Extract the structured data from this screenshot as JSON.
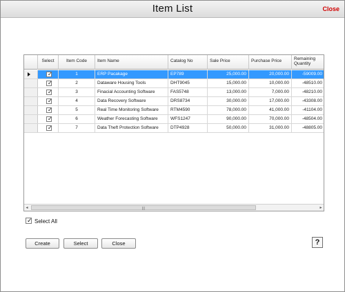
{
  "window": {
    "title": "Item List",
    "close_label": "Close"
  },
  "grid": {
    "columns": [
      "Select",
      "Item Code",
      "Item Name",
      "Catalog No",
      "Sale Price",
      "Purchase Price",
      "Remaining Quantity"
    ],
    "rows": [
      {
        "selected": true,
        "checked": true,
        "code": "1",
        "name": "ERP Pacakage",
        "catalog": "EP789",
        "sale": "25,000.00",
        "purchase": "20,000.00",
        "remaining": "-59009.00"
      },
      {
        "selected": false,
        "checked": true,
        "code": "2",
        "name": "Dataware Housing Tools",
        "catalog": "DHT9045",
        "sale": "15,000.00",
        "purchase": "10,000.00",
        "remaining": "-48510.00"
      },
      {
        "selected": false,
        "checked": true,
        "code": "3",
        "name": "Finacial Accounting Software",
        "catalog": "FAS5748",
        "sale": "13,000.00",
        "purchase": "7,000.00",
        "remaining": "-48210.00"
      },
      {
        "selected": false,
        "checked": true,
        "code": "4",
        "name": "Data Recovery Software",
        "catalog": "DRS8734",
        "sale": "30,000.00",
        "purchase": "17,000.00",
        "remaining": "-43308.00"
      },
      {
        "selected": false,
        "checked": true,
        "code": "5",
        "name": "Real Time Monitoring Software",
        "catalog": "RTM4590",
        "sale": "78,000.00",
        "purchase": "41,000.00",
        "remaining": "-41104.00"
      },
      {
        "selected": false,
        "checked": true,
        "code": "6",
        "name": "Weather Forecasting Software",
        "catalog": "WFS1247",
        "sale": "90,000.00",
        "purchase": "70,000.00",
        "remaining": "-48504.00"
      },
      {
        "selected": false,
        "checked": true,
        "code": "7",
        "name": "Data Theft Protection Software",
        "catalog": "DTP4928",
        "sale": "50,000.00",
        "purchase": "31,000.00",
        "remaining": "-48805.00"
      }
    ]
  },
  "select_all": {
    "label": "Select All",
    "checked": true
  },
  "buttons": {
    "create": "Create",
    "select": "Select",
    "close": "Close",
    "help": "?"
  },
  "colors": {
    "selection": "#3399ff",
    "close_link": "#d00000"
  },
  "icons": {
    "checkbox_checked": "✓",
    "row_indicator": "triangle-right",
    "scroll_left": "◂",
    "scroll_right": "▸"
  }
}
